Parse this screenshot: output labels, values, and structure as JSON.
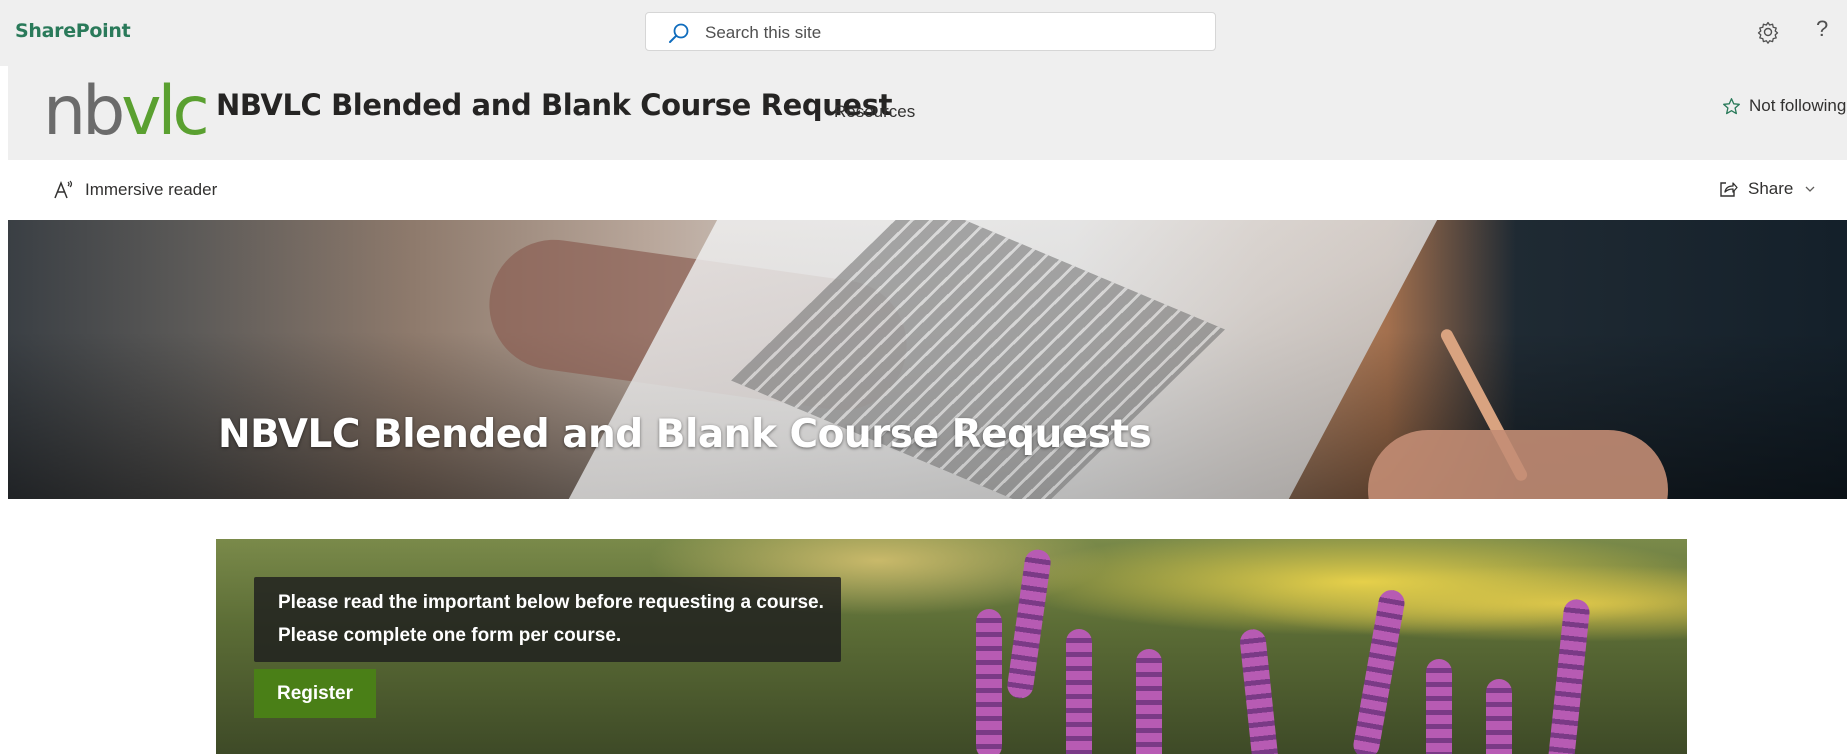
{
  "suite_bar": {
    "brand": "SharePoint",
    "search_placeholder": "Search this site",
    "settings_icon": "gear-icon",
    "help_label": "?"
  },
  "site_header": {
    "logo_nb": "nb",
    "logo_vlc": "vlc",
    "title": "NBVLC Blended and Blank Course Request",
    "nav": [
      {
        "label": "Resources"
      }
    ],
    "follow_label": "Not following",
    "follow_icon": "star-icon"
  },
  "command_bar": {
    "immersive_reader_label": "Immersive reader",
    "share_label": "Share"
  },
  "hero": {
    "title": "NBVLC Blended and Blank Course Requests"
  },
  "feature": {
    "line1": "Please read the important below before requesting a course.",
    "line2": "Please complete one form per course.",
    "button_label": "Register"
  },
  "colors": {
    "brand_green": "#2a7a5a",
    "logo_gray": "#6b6b6b",
    "logo_green": "#5aa030",
    "register_button": "#4a7f17"
  }
}
